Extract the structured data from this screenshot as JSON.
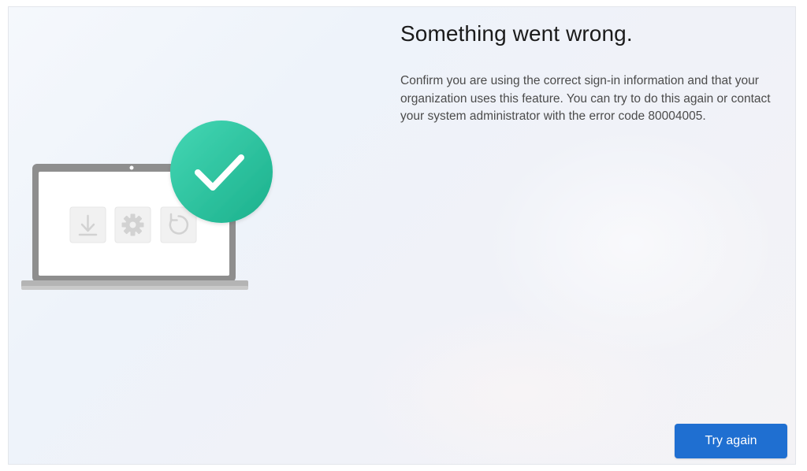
{
  "dialog": {
    "title": "Something went wrong.",
    "message": "Confirm you are using the correct sign-in information and that your organization uses this feature. You can try to do this again or contact your system administrator with the error code 80004005.",
    "primary_button_label": "Try again"
  },
  "illustration": {
    "laptop_icons": [
      "download-icon",
      "gear-icon",
      "refresh-icon"
    ],
    "badge_icon": "checkmark-icon"
  },
  "colors": {
    "accent": "#1f6fd1",
    "badge": "#2cc4a1",
    "title_text": "#1b1b1b",
    "body_text": "#4b4b4b"
  }
}
